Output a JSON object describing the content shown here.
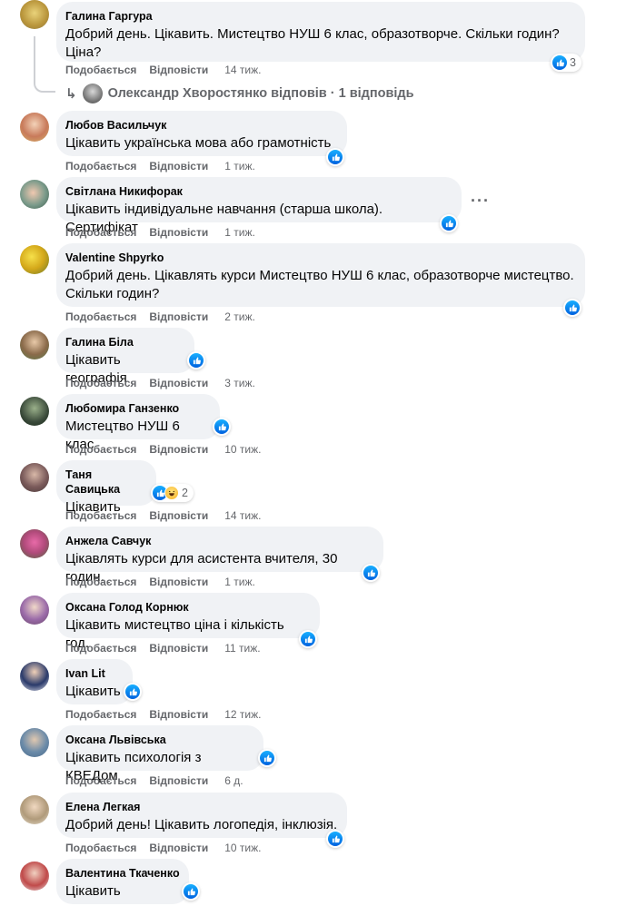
{
  "actions": {
    "like": "Подобається",
    "reply": "Відповісти"
  },
  "comments": [
    {
      "author": "Галина Гаргура",
      "text": "Добрий день. Цікавить. Мистецтво НУШ 6 клас, образотворче. Скільки годин? Ціна?",
      "time": "14 тиж.",
      "reaction_count": "3"
    },
    {
      "author": "Любов Васильчук",
      "text": "Цікавить українська мова або грамотність",
      "time": "1 тиж."
    },
    {
      "author": "Світлана Никифорак",
      "text": "Цікавить індивідуальне навчання (старша школа). Сертифікат",
      "time": "1 тиж."
    },
    {
      "author": "Valentine Shpyrko",
      "text": "Добрий день. Цікавлять курси Мистецтво НУШ 6 клас, образотворче мистецтво. Скільки годин?",
      "time": "2 тиж."
    },
    {
      "author": "Галина Біла",
      "text": "Цікавить географія",
      "time": "3 тиж."
    },
    {
      "author": "Любомира Ганзенко",
      "text": "Мистецтво НУШ 6 клас",
      "time": "10 тиж."
    },
    {
      "author": "Таня Савицька",
      "text": "Цікавить",
      "time": "14 тиж.",
      "reaction_count": "2"
    },
    {
      "author": "Анжела Савчук",
      "text": "Цікавлять курси для асистента вчителя, 30 годин.",
      "time": "1 тиж."
    },
    {
      "author": "Оксана Голод Корнюк",
      "text": "Цікавить мистецтво ціна і кількість год.",
      "time": "11 тиж."
    },
    {
      "author": "Ivan Lit",
      "text": "Цікавить",
      "time": "12 тиж."
    },
    {
      "author": "Оксана Львівська",
      "text": "Цікавить психологія з КВЕДом",
      "time": "6 д."
    },
    {
      "author": "Елена Легкая",
      "text": "Добрий день! Цікавить логопедія, інклюзія.",
      "time": "10 тиж."
    },
    {
      "author": "Валентина Ткаченко",
      "text": "Цікавить"
    }
  ],
  "replies": {
    "author": "Олександр Хворостянко",
    "verb": "відповів",
    "count_text": "1 відповідь",
    "separator": "·"
  },
  "icons": {
    "like": "like-reaction-icon",
    "haha": "haha-reaction-icon",
    "reply_arrow": "reply-arrow-icon",
    "more": "more-options-icon"
  },
  "colors": {
    "bubble": "#f0f2f5",
    "meta": "#65676b",
    "like_blue": "#1877f2"
  }
}
